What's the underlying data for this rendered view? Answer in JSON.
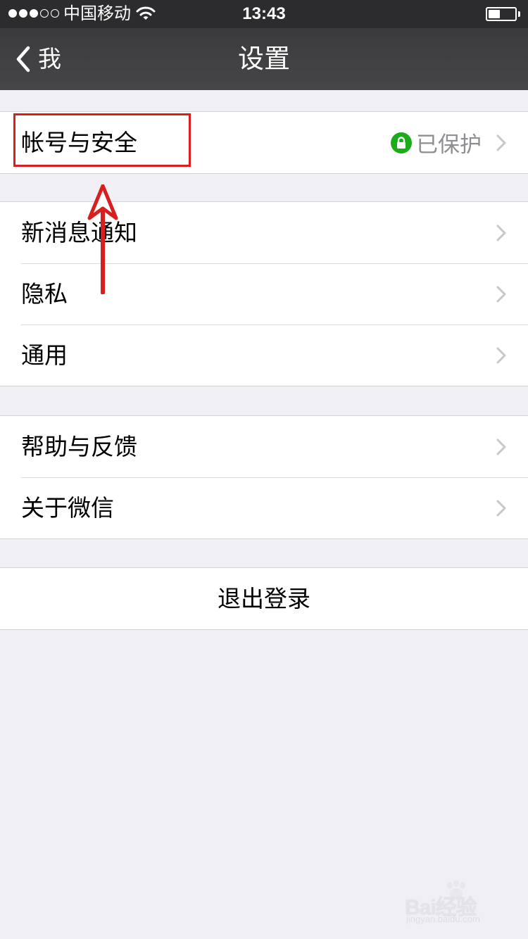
{
  "status_bar": {
    "carrier": "中国移动",
    "time": "13:43",
    "signal_bars_filled": 3,
    "signal_bars_total": 5,
    "battery_level": 0.45
  },
  "nav": {
    "back_label": "我",
    "title": "设置"
  },
  "groups": [
    {
      "rows": [
        {
          "label": "帐号与安全",
          "value": "已保护",
          "value_icon": "lock-icon",
          "value_icon_color": "#1aad19"
        }
      ]
    },
    {
      "rows": [
        {
          "label": "新消息通知"
        },
        {
          "label": "隐私"
        },
        {
          "label": "通用"
        }
      ]
    },
    {
      "rows": [
        {
          "label": "帮助与反馈"
        },
        {
          "label": "关于微信"
        }
      ]
    }
  ],
  "logout_label": "退出登录",
  "annotation": {
    "color": "#d81e1e"
  },
  "watermark": {
    "text": "Bai经验",
    "sub_text": "jingyan.baidu.com"
  }
}
